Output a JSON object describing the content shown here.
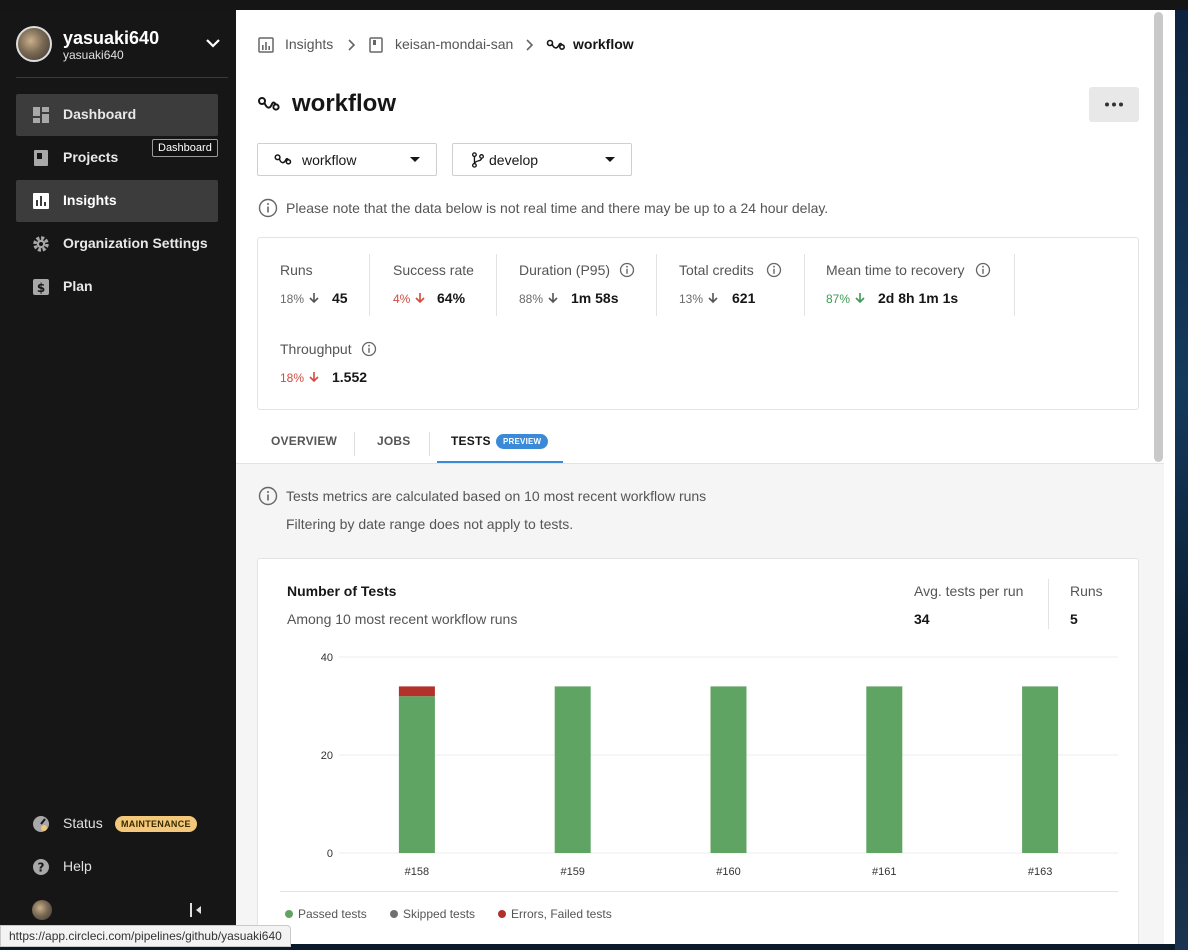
{
  "sidebar": {
    "user": {
      "name": "yasuaki640",
      "login": "yasuaki640"
    },
    "items": [
      {
        "label": "Dashboard",
        "icon": "dashboard-icon"
      },
      {
        "label": "Projects",
        "icon": "projects-icon"
      },
      {
        "label": "Insights",
        "icon": "insights-icon"
      },
      {
        "label": "Organization Settings",
        "icon": "gear-icon"
      },
      {
        "label": "Plan",
        "icon": "dollar-icon"
      }
    ],
    "tooltip": "Dashboard",
    "status_label": "Status",
    "maintenance_badge": "MAINTENANCE",
    "help_label": "Help"
  },
  "breadcrumb": {
    "insights": "Insights",
    "project": "keisan-mondai-san",
    "workflow": "workflow"
  },
  "page": {
    "title": "workflow",
    "workflow_select": "workflow",
    "branch_select": "develop",
    "notice": "Please note that the data below is not real time and there may be up to a 24 hour delay."
  },
  "metrics": [
    {
      "label": "Runs",
      "change": "18%",
      "value": "45",
      "trend": "down",
      "color": "gray"
    },
    {
      "label": "Success rate",
      "change": "4%",
      "value": "64%",
      "trend": "down",
      "color": "red"
    },
    {
      "label": "Duration (P95)",
      "change": "88%",
      "value": "1m 58s",
      "trend": "down",
      "color": "gray"
    },
    {
      "label": "Total credits",
      "change": "13%",
      "value": "621",
      "trend": "down",
      "color": "gray"
    },
    {
      "label": "Mean time to recovery",
      "change": "87%",
      "value": "2d 8h 1m 1s",
      "trend": "down",
      "color": "green"
    },
    {
      "label": "Throughput",
      "change": "18%",
      "value": "1.552",
      "trend": "down",
      "color": "red"
    }
  ],
  "tabs": {
    "overview": "OVERVIEW",
    "jobs": "JOBS",
    "tests": "TESTS",
    "preview": "PREVIEW"
  },
  "tests": {
    "note1": "Tests metrics are calculated based on 10 most recent workflow runs",
    "note2": "Filtering by date range does not apply to tests.",
    "card_title": "Number of Tests",
    "card_sub": "Among 10 most recent workflow runs",
    "avg_label": "Avg. tests per run",
    "avg_value": "34",
    "runs_label": "Runs",
    "runs_value": "5"
  },
  "chart_data": {
    "type": "bar",
    "stacked": true,
    "categories": [
      "#158",
      "#159",
      "#160",
      "#161",
      "#163"
    ],
    "series": [
      {
        "name": "Passed tests",
        "color": "#5fa463",
        "values": [
          32,
          34,
          34,
          34,
          34
        ]
      },
      {
        "name": "Skipped tests",
        "color": "#707070",
        "values": [
          0,
          0,
          0,
          0,
          0
        ]
      },
      {
        "name": "Errors, Failed tests",
        "color": "#b3312b",
        "values": [
          2,
          0,
          0,
          0,
          0
        ]
      }
    ],
    "yticks": [
      0,
      20,
      40
    ],
    "ylim": [
      0,
      40
    ],
    "grid": true,
    "legend": "bottom-left"
  },
  "status_url": "https://app.circleci.com/pipelines/github/yasuaki640"
}
